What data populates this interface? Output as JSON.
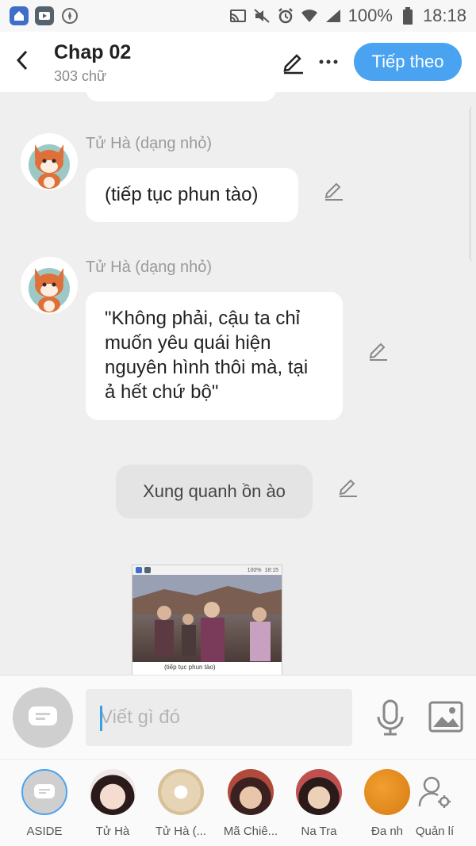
{
  "status_bar": {
    "battery": "100%",
    "time": "18:18"
  },
  "header": {
    "title": "Chap 02",
    "subtitle": "303 chữ",
    "next_label": "Tiếp theo"
  },
  "messages": [
    {
      "sender": "Tử Hà (dạng nhỏ)",
      "text": "(tiếp tục phun tào)"
    },
    {
      "sender": "Tử Hà (dạng nhỏ)",
      "text": "\"Không phải, cậu ta chỉ muốn yêu quái hiện nguyên hình thôi mà, tại ả hết chứ bộ\""
    }
  ],
  "narration": "Xung quanh ồn ào",
  "thumbnail": {
    "status_battery": "100%",
    "status_time": "18:15",
    "caption": "(tiếp tục phun tào)"
  },
  "composer": {
    "placeholder": "Viết gì đó"
  },
  "characters": [
    {
      "name": "ASIDE",
      "icon": "aside-chat-icon"
    },
    {
      "name": "Tử Hà",
      "icon": "avatar"
    },
    {
      "name": "Tử Hà (...",
      "icon": "avatar"
    },
    {
      "name": "Mã Chiê...",
      "icon": "avatar"
    },
    {
      "name": "Na Tra",
      "icon": "avatar"
    },
    {
      "name": "Đa nh",
      "icon": "avatar"
    },
    {
      "name": "Quản lí",
      "icon": "user-settings-icon"
    }
  ],
  "colors": {
    "accent": "#4aa3f0",
    "background": "#efefef"
  }
}
